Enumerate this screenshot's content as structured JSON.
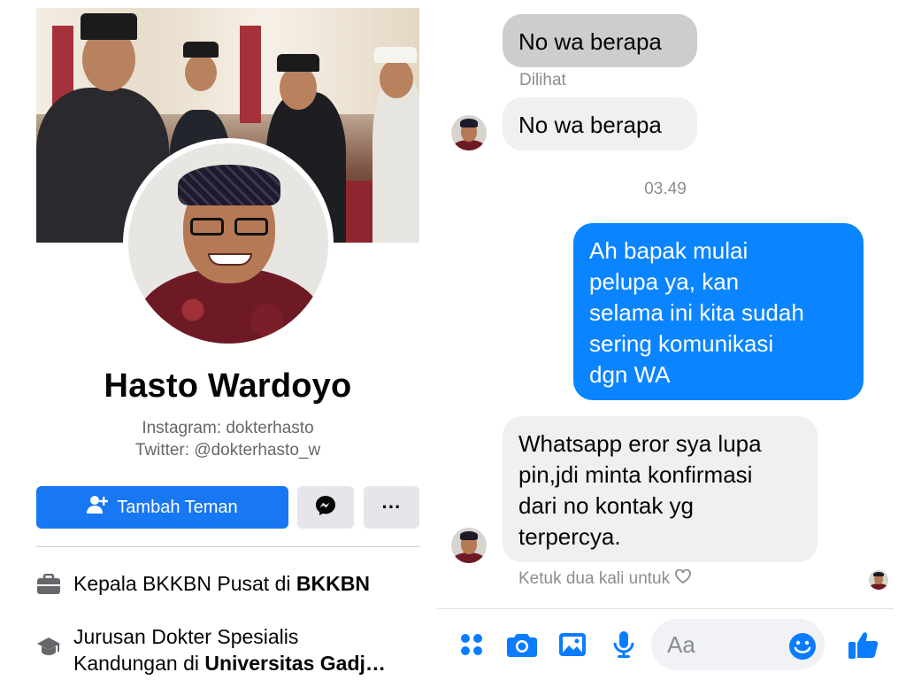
{
  "profile": {
    "name": "Hasto Wardoyo",
    "bio_line1": "Instagram: dokterhasto",
    "bio_line2": "Twitter: @dokterhasto_w",
    "add_friend_label": "Tambah Teman",
    "more_label": "···",
    "work": {
      "prefix": "Kepala BKKBN Pusat di ",
      "org": "BKKBN"
    },
    "education": {
      "line1": "Jurusan Dokter Spesialis",
      "prefix2": "Kandungan di ",
      "school": "Universitas Gadj…"
    }
  },
  "chat": {
    "messages": [
      {
        "text": "No wa berapa"
      },
      {
        "status": "Dilihat"
      },
      {
        "text": "No wa berapa"
      },
      {
        "timestamp": "03.49"
      },
      {
        "text_lines": [
          "Ah bapak mulai",
          "pelupa ya, kan",
          "selama ini kita sudah",
          "sering komunikasi",
          "dgn WA"
        ]
      },
      {
        "text_lines": [
          "Whatsapp eror sya lupa",
          "pin,jdi minta konfirmasi",
          "dari no kontak yg",
          "terpercya."
        ]
      }
    ],
    "hint": "Ketuk dua kali untuk",
    "composer_placeholder": "Aa"
  },
  "colors": {
    "brand_blue": "#1877f2",
    "bubble_blue": "#0a84ff",
    "icon_blue": "#0a7cff"
  },
  "icons": [
    "add-friend-icon",
    "messenger-icon",
    "briefcase-icon",
    "graduation-cap-icon",
    "menu-dots-icon",
    "camera-icon",
    "image-icon",
    "mic-icon",
    "emoji-icon",
    "like-icon",
    "heart-icon"
  ]
}
